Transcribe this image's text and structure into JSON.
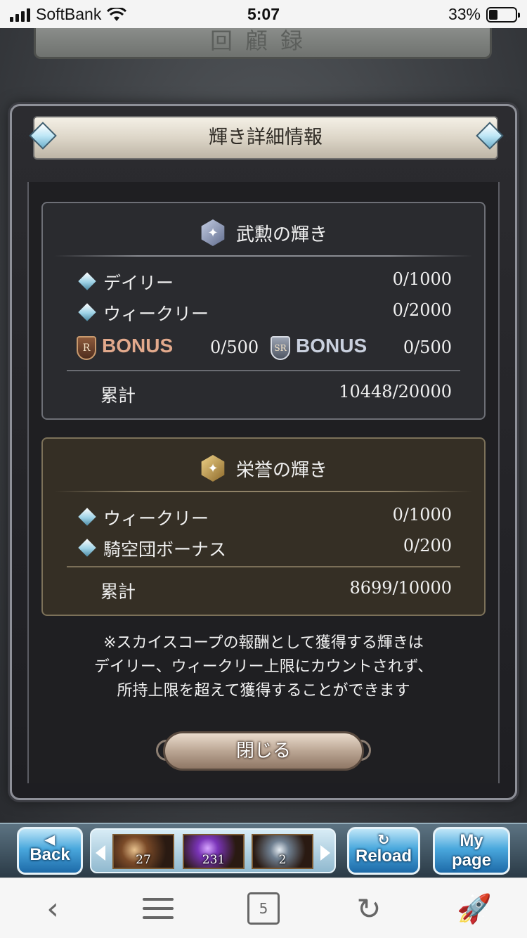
{
  "status_bar": {
    "carrier": "SoftBank",
    "time": "5:07",
    "battery": "33%",
    "battery_level": 0.33
  },
  "background": {
    "header_plate": "回顧録"
  },
  "dialog": {
    "title": "輝き詳細情報",
    "section_bukun": {
      "title": "武勲の輝き",
      "rows": [
        {
          "label": "デイリー",
          "value": "0/1000"
        },
        {
          "label": "ウィークリー",
          "value": "0/2000"
        }
      ],
      "bonus": [
        {
          "badge": "R",
          "label": "BONUS",
          "value": "0/500"
        },
        {
          "badge": "SR",
          "label": "BONUS",
          "value": "0/500"
        }
      ],
      "total_label": "累計",
      "total_value": "10448/20000"
    },
    "section_eiyo": {
      "title": "栄誉の輝き",
      "rows": [
        {
          "label": "ウィークリー",
          "value": "0/1000"
        },
        {
          "label": "騎空団ボーナス",
          "value": "0/200"
        }
      ],
      "total_label": "累計",
      "total_value": "8699/10000"
    },
    "note_lines": [
      "※スカイスコープの報酬として獲得する輝きは",
      "デイリー、ウィークリー上限にカウントされず、",
      "所持上限を超えて獲得することができます"
    ],
    "close_label": "閉じる"
  },
  "game_nav": {
    "back_label_1": "◀",
    "back_label_2": "Back",
    "reload_label_1": "↻",
    "reload_label_2": "Reload",
    "mypage_label_1": "My",
    "mypage_label_2": "page",
    "items": [
      {
        "icon": "elixir-item",
        "count": "27"
      },
      {
        "icon": "soul-berry-item",
        "count": "231"
      },
      {
        "icon": "silver-item",
        "count": "2"
      }
    ]
  },
  "browser_toolbar": {
    "back_icon": "chevron-left",
    "menu_icon": "hamburger",
    "tab_count": "5",
    "reload_icon": "reload",
    "rocket_icon": "rocket"
  }
}
